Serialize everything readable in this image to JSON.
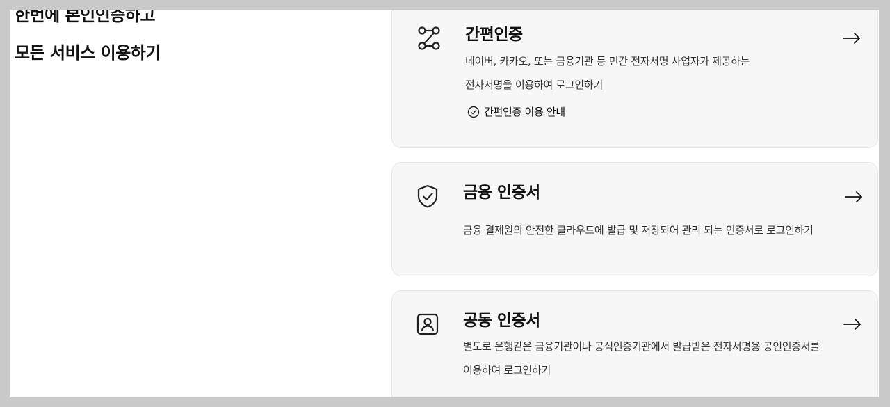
{
  "headline": {
    "line1": "한번에 본인인증하고",
    "line2": "모든 서비스 이용하기"
  },
  "cards": [
    {
      "icon": "flow-icon",
      "title": "간편인증",
      "desc_line1": "네이버, 카카오, 또는 금융기관 등 민간 전자서명 사업자가 제공하는",
      "desc_line2": "전자서명을 이용하여 로그인하기",
      "link_label": "간편인증 이용 안내",
      "link_icon": "check-circle-icon"
    },
    {
      "icon": "shield-check-icon",
      "title": "금융 인증서",
      "desc_line1": "금융 결제원의 안전한 클라우드에 발급 및 저장되어 관리 되는 인증서로 로그인하기"
    },
    {
      "icon": "user-badge-icon",
      "title": "공동 인증서",
      "desc_line1": "별도로 은행같은 금융기관이나 공식인증기관에서 발급받은 전자서명용 공인인증서를",
      "desc_line2": "이용하여 로그인하기"
    }
  ],
  "colors": {
    "page_bg": "#ffffff",
    "card_bg": "#f7f7f7",
    "card_border": "#e7e7e7",
    "outer_bg": "#c9c9c9",
    "text": "#111111"
  }
}
